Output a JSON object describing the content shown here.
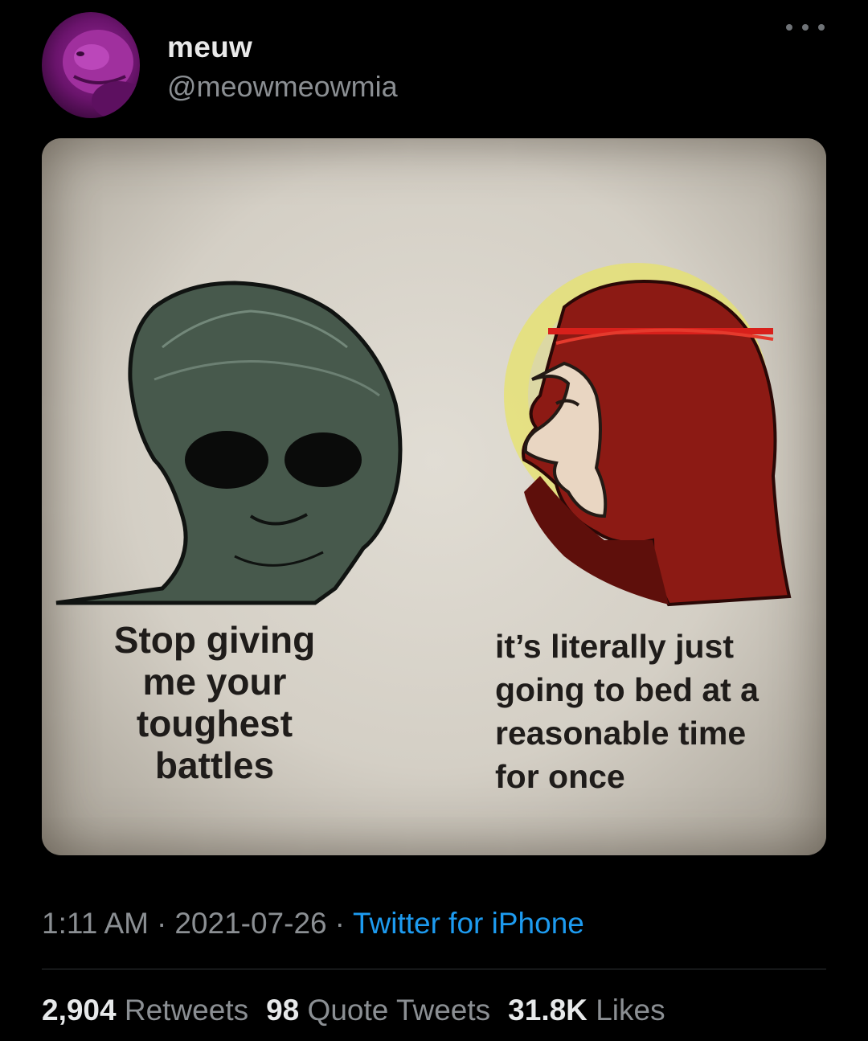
{
  "tweet": {
    "display_name": "meuw",
    "handle": "@meowmeowmia",
    "more_icon": "more-horizontal-icon",
    "avatar_icon": "avatar-pink-creature",
    "media": {
      "caption_left": "Stop giving\nme your\ntoughest\nbattles",
      "caption_right": "it’s literally just\ngoing to bed at a\nreasonable time\nfor once"
    },
    "time": "1:11 AM",
    "separator": "·",
    "date": "2021-07-26",
    "source": "Twitter for iPhone",
    "stats": {
      "retweets_count": "2,904",
      "retweets_label": "Retweets",
      "quotes_count": "98",
      "quotes_label": "Quote Tweets",
      "likes_count": "31.8K",
      "likes_label": "Likes"
    }
  },
  "colors": {
    "background": "#000000",
    "text_primary": "#e7e9ea",
    "text_secondary": "#8b8f93",
    "link": "#1d9bf0",
    "divider": "#2f3336"
  }
}
